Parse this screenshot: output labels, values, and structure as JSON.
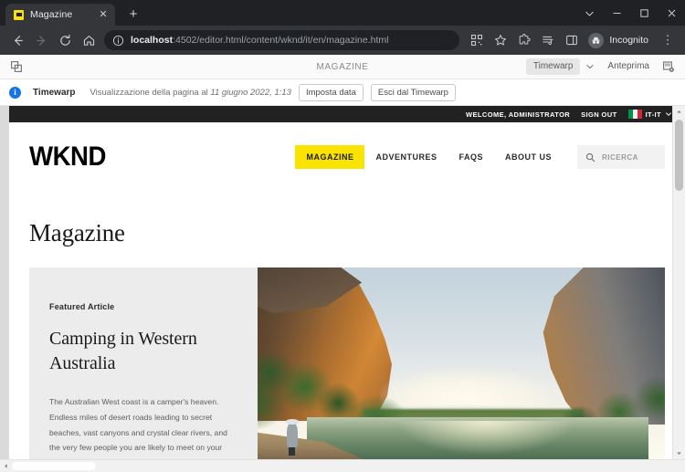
{
  "browser": {
    "tab": {
      "title": "Magazine",
      "favicon_name": "wknd-favicon",
      "close_label": "✕"
    },
    "new_tab_label": "+",
    "window_controls": {
      "minimize": "minimize-button",
      "maximize": "maximize-button",
      "close": "close-button",
      "more": "window-more-button"
    },
    "nav": {
      "back": "←",
      "forward": "→",
      "reload": "↻",
      "home": "⌂"
    },
    "omnibox": {
      "host": "localhost",
      "path": ":4502/editor.html/content/wknd/it/en/magazine.html",
      "full_url": "localhost:4502/editor.html/content/wknd/it/en/magazine.html",
      "info_icon": "site-info-icon"
    },
    "toolbar_icons": [
      "qr-code-icon",
      "bookmark-star-icon",
      "extensions-puzzle-icon",
      "reading-list-icon",
      "side-panel-icon"
    ],
    "profile": {
      "label": "Incognito",
      "avatar_icon": "incognito-hat-icon"
    },
    "menu_label": "⋮"
  },
  "aem_editor": {
    "rail_toggle_icon": "side-rail-toggle-icon",
    "page_title": "MAGAZINE",
    "mode_selector": {
      "label": "Timewarp",
      "caret_icon": "chevron-down-icon"
    },
    "preview_button": "Anteprima",
    "page_properties_icon": "page-properties-icon"
  },
  "timewarp_bar": {
    "info_icon": "info-circle-icon",
    "info_glyph": "i",
    "label": "Timewarp",
    "message_prefix": "Visualizzazione della pagina al ",
    "message_date": "11 giugno 2022, 1:13",
    "set_date_button": "Imposta data",
    "exit_button": "Esci dal Timewarp"
  },
  "site": {
    "topbar": {
      "welcome": "WELCOME, ADMINISTRATOR",
      "sign_out": "SIGN OUT",
      "flag_name": "italy-flag-icon",
      "language": "IT-IT",
      "language_caret_icon": "chevron-down-icon"
    },
    "logo": "WKND",
    "nav": [
      {
        "label": "MAGAZINE",
        "active": true
      },
      {
        "label": "ADVENTURES",
        "active": false
      },
      {
        "label": "FAQS",
        "active": false
      },
      {
        "label": "ABOUT US",
        "active": false
      }
    ],
    "search": {
      "placeholder": "RICERCA",
      "icon": "search-icon"
    },
    "page_title": "Magazine",
    "featured": {
      "eyebrow": "Featured Article",
      "title": "Camping in Western Australia",
      "body": "The Australian West coast is a camper's heaven. Endless miles of desert roads leading to secret beaches, vast canyons and crystal clear rivers, and the very few people you are likely to meet on your journey will be some of the most easy-",
      "image_alt": "Gorge with orange sunlit cliffs, green trees and a reflective river"
    }
  },
  "colors": {
    "accent_yellow": "#fae300",
    "site_dark": "#222222",
    "browser_chrome": "#35363a",
    "browser_dark": "#202124",
    "info_blue": "#1473e6"
  },
  "scrollbars": {
    "vertical_up_icon": "scroll-up-arrow-icon",
    "vertical_down_icon": "scroll-down-arrow-icon",
    "horizontal_left_icon": "scroll-left-arrow-icon"
  }
}
